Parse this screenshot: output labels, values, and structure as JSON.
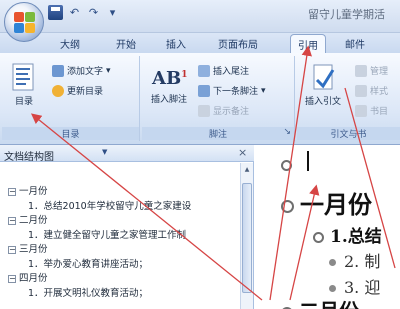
{
  "window": {
    "title": "留守儿童学期活"
  },
  "quick_access": {
    "icons": [
      "save-icon",
      "undo-icon",
      "redo-icon"
    ],
    "customize_glyph": "▾"
  },
  "tabs": [
    {
      "label": "开始"
    },
    {
      "label": "插入"
    },
    {
      "label": "页面布局"
    },
    {
      "label": "引用",
      "active": true
    },
    {
      "label": "邮件"
    }
  ],
  "tab_partial": "大纲",
  "ribbon": {
    "toc_group": {
      "label": "目录",
      "toc_button": "目录",
      "add_text": "添加文字",
      "add_text_dropdown": "▾",
      "update_toc": "更新目录"
    },
    "footnotes_group": {
      "label": "脚注",
      "insert_footnote": "插入脚注",
      "footnote_icon_text": "AB",
      "footnote_icon_sup": "1",
      "insert_endnote": "插入尾注",
      "next_footnote": "下一条脚注",
      "next_footnote_dropdown": "▾",
      "show_notes": "显示备注",
      "dialog_launcher_glyph": "↘"
    },
    "citations_group": {
      "label": "引文与书",
      "insert_citation": "插入引文",
      "manage_sources": "管理",
      "style": "样式",
      "bibliography": "书目"
    }
  },
  "nav_pane": {
    "title": "文档结构图",
    "dropdown_glyph": "▼",
    "close_glyph": "×",
    "items": [
      {
        "level": 1,
        "expander": "⊟",
        "text": "一月份"
      },
      {
        "level": 2,
        "text": "1．总结2010年学校留守儿童之家建设"
      },
      {
        "level": 1,
        "expander": "⊟",
        "text": "二月份"
      },
      {
        "level": 2,
        "text": "1．建立健全留守儿童之家管理工作制"
      },
      {
        "level": 1,
        "expander": "⊟",
        "text": "三月份"
      },
      {
        "level": 2,
        "text": "1．举办爱心教育讲座活动；"
      },
      {
        "level": 1,
        "expander": "⊟",
        "text": "四月份"
      },
      {
        "level": 2,
        "text": "1．开展文明礼仪教育活动；"
      }
    ]
  },
  "document": {
    "lines": [
      {
        "text": "一月份"
      },
      {
        "text": "1.总结"
      },
      {
        "text": "2. 制"
      },
      {
        "text": "3. 迎"
      },
      {
        "text": "二月份"
      }
    ]
  },
  "colors": {
    "ribbon_blue": "#dce7f7",
    "active_tab": "#f5f9ff",
    "annotation_red": "#d64545"
  }
}
